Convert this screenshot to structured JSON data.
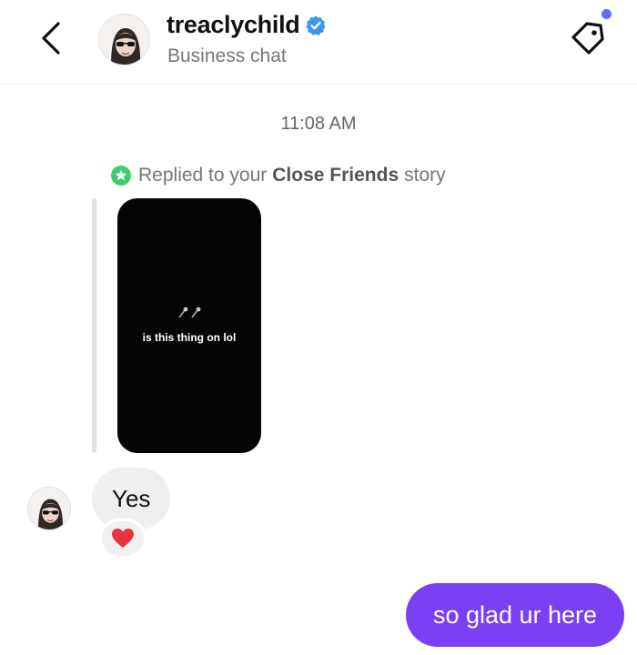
{
  "header": {
    "username": "treaclychild",
    "subtitle": "Business chat",
    "icons": {
      "back": "chevron-left-icon",
      "verified": "verified-badge-icon",
      "tag": "tag-icon"
    },
    "notification_dot_color": "#5b6cff"
  },
  "thread": {
    "timestamp": "11:08 AM",
    "story_reply": {
      "prefix": "Replied to your",
      "audience": "Close Friends",
      "suffix": "story",
      "badge_icon": "close-friends-star-icon",
      "badge_color": "#3ccf6d",
      "story_text": "is this thing on lol",
      "story_icon": "microphone-icon"
    },
    "messages": [
      {
        "direction": "incoming",
        "text": "Yes",
        "reaction": "red-heart"
      },
      {
        "direction": "outgoing",
        "text": "so glad ur here",
        "bubble_color": "#7a40f5"
      }
    ]
  }
}
